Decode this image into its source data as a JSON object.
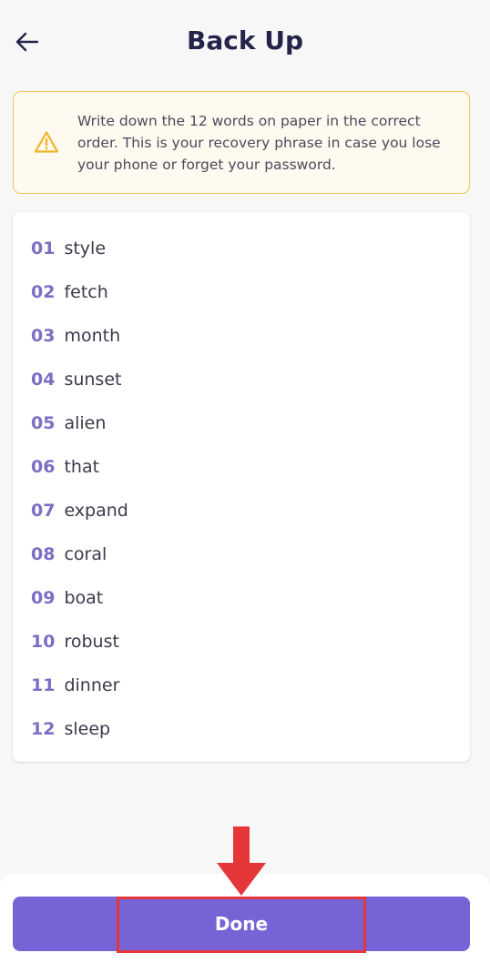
{
  "header": {
    "title": "Back Up",
    "back_icon": "arrow-left-icon"
  },
  "warning": {
    "icon": "warning-triangle-icon",
    "text": "Write down the 12 words on paper in the correct order. This is your recovery phrase in case you lose your phone or forget your password.",
    "border_color": "#f2c25a"
  },
  "words": [
    {
      "num": "01",
      "word": "style"
    },
    {
      "num": "02",
      "word": "fetch"
    },
    {
      "num": "03",
      "word": "month"
    },
    {
      "num": "04",
      "word": "sunset"
    },
    {
      "num": "05",
      "word": "alien"
    },
    {
      "num": "06",
      "word": "that"
    },
    {
      "num": "07",
      "word": "expand"
    },
    {
      "num": "08",
      "word": "coral"
    },
    {
      "num": "09",
      "word": "boat"
    },
    {
      "num": "10",
      "word": "robust"
    },
    {
      "num": "11",
      "word": "dinner"
    },
    {
      "num": "12",
      "word": "sleep"
    }
  ],
  "footer": {
    "done_label": "Done"
  },
  "annotation": {
    "arrow_icon": "arrow-down-icon",
    "color": "#e5373a"
  },
  "colors": {
    "accent": "#7763d5",
    "number": "#7b6fc4",
    "title": "#24244a"
  }
}
